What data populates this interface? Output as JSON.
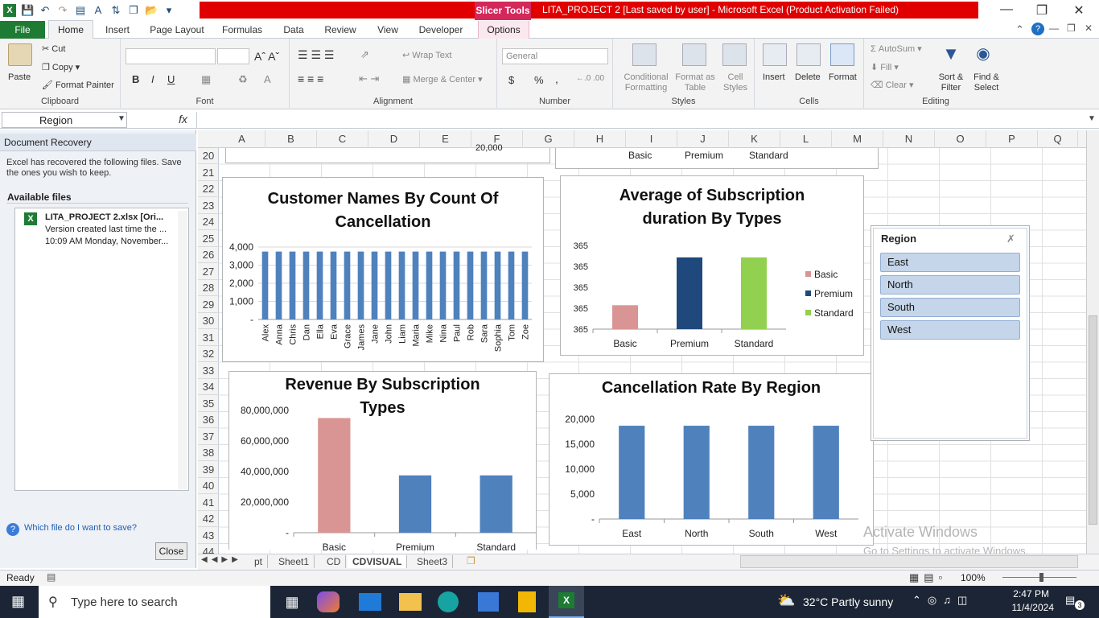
{
  "window": {
    "title": "LITA_PROJECT 2 [Last saved by user]  -  Microsoft Excel (Product Activation Failed)",
    "context_tab": "Slicer Tools"
  },
  "ribbon": {
    "tabs": [
      "File",
      "Home",
      "Insert",
      "Page Layout",
      "Formulas",
      "Data",
      "Review",
      "View",
      "Developer",
      "Options"
    ],
    "clipboard": {
      "paste": "Paste",
      "cut": "Cut",
      "copy": "Copy",
      "format_painter": "Format Painter",
      "label": "Clipboard"
    },
    "font": {
      "label": "Font",
      "bold": "B",
      "italic": "I",
      "underline": "U"
    },
    "alignment": {
      "wrap": "Wrap Text",
      "merge": "Merge & Center",
      "label": "Alignment"
    },
    "number": {
      "format": "General",
      "label": "Number",
      "currency": "$",
      "percent": "%",
      "comma": ","
    },
    "styles": {
      "conditional": "Conditional Formatting",
      "format_table": "Format as Table",
      "cell_styles": "Cell Styles",
      "label": "Styles"
    },
    "cells": {
      "insert": "Insert",
      "delete": "Delete",
      "format": "Format",
      "label": "Cells"
    },
    "editing": {
      "autosum": "AutoSum",
      "fill": "Fill",
      "clear": "Clear",
      "sort": "Sort & Filter",
      "find": "Find & Select",
      "label": "Editing"
    }
  },
  "formula_bar": {
    "name_box": "Region",
    "fx": "fx",
    "value": ""
  },
  "recovery": {
    "header": "Document Recovery",
    "description": "Excel has recovered the following files.  Save the ones you wish to keep.",
    "available": "Available files",
    "file_name": "LITA_PROJECT 2.xlsx  [Ori...",
    "file_line2": "Version created last time the ...",
    "file_line3": "10:09 AM Monday, November...",
    "help": "Which file do I want to save?",
    "close": "Close"
  },
  "columns": [
    "A",
    "B",
    "C",
    "D",
    "E",
    "F",
    "G",
    "H",
    "I",
    "J",
    "K",
    "L",
    "M",
    "N",
    "O",
    "P",
    "Q"
  ],
  "rows": [
    "20",
    "21",
    "22",
    "23",
    "24",
    "25",
    "26",
    "27",
    "28",
    "29",
    "30",
    "31",
    "32",
    "33",
    "34",
    "35",
    "36",
    "37",
    "38",
    "39",
    "40",
    "41",
    "42",
    "43",
    "44"
  ],
  "top_fragments": {
    "left_value": "20,000",
    "cats": [
      "Basic",
      "Premium",
      "Standard"
    ]
  },
  "chart_data": [
    {
      "type": "bar",
      "title": "Customer Names By Count Of Cancellation",
      "categories": [
        "Alex",
        "Anna",
        "Chris",
        "Dan",
        "Ella",
        "Eva",
        "Grace",
        "James",
        "Jane",
        "John",
        "Liam",
        "Maria",
        "Mike",
        "Nina",
        "Paul",
        "Rob",
        "Sara",
        "Sophia",
        "Tom",
        "Zoe"
      ],
      "values": [
        3750,
        3750,
        3750,
        3750,
        3750,
        3750,
        3750,
        3750,
        3750,
        3750,
        3750,
        3750,
        3750,
        3750,
        3750,
        3750,
        3750,
        3750,
        3750,
        3750
      ],
      "yticks": [
        "4,000",
        "3,000",
        "2,000",
        "1,000",
        "-"
      ],
      "ylim": [
        0,
        4000
      ],
      "color": "#4f81bd"
    },
    {
      "type": "bar",
      "title": "Average of Subscription duration By Types",
      "categories": [
        "Basic",
        "Premium",
        "Standard"
      ],
      "series": [
        {
          "name": "Basic",
          "color": "#d99594"
        },
        {
          "name": "Premium",
          "color": "#1f497d"
        },
        {
          "name": "Standard",
          "color": "#92d050"
        }
      ],
      "values": [
        364.8,
        365.2,
        365.2
      ],
      "yticks": [
        "365",
        "365",
        "365",
        "365",
        "365"
      ],
      "ylim": [
        364.6,
        365.3
      ],
      "legend": "right"
    },
    {
      "type": "bar",
      "title": "Revenue By Subscription Types",
      "categories": [
        "Basic",
        "Premium",
        "Standard"
      ],
      "values": [
        75000000,
        37500000,
        37500000
      ],
      "colors": [
        "#d99594",
        "#4f81bd",
        "#4f81bd"
      ],
      "yticks": [
        "80,000,000",
        "60,000,000",
        "40,000,000",
        "20,000,000",
        "-"
      ],
      "ylim": [
        0,
        80000000
      ]
    },
    {
      "type": "bar",
      "title": "Cancellation Rate By Region",
      "categories": [
        "East",
        "North",
        "South",
        "West"
      ],
      "values": [
        18700,
        18700,
        18700,
        18700
      ],
      "color": "#4f81bd",
      "yticks": [
        "20,000",
        "15,000",
        "10,000",
        "5,000",
        "-"
      ],
      "ylim": [
        0,
        20000
      ]
    }
  ],
  "slicer": {
    "title": "Region",
    "items": [
      "East",
      "North",
      "South",
      "West"
    ]
  },
  "sheets": [
    "pt",
    "Sheet1",
    "CD",
    "CDVISUAL",
    "Sheet3"
  ],
  "status": {
    "ready": "Ready",
    "zoom": "100%"
  },
  "watermark": {
    "line1": "Activate Windows",
    "line2": "Go to Settings to activate Windows."
  },
  "taskbar": {
    "search": "Type here to search",
    "weather": "32°C  Partly sunny",
    "time": "2:47 PM",
    "date": "11/4/2024",
    "notifications": "3"
  }
}
